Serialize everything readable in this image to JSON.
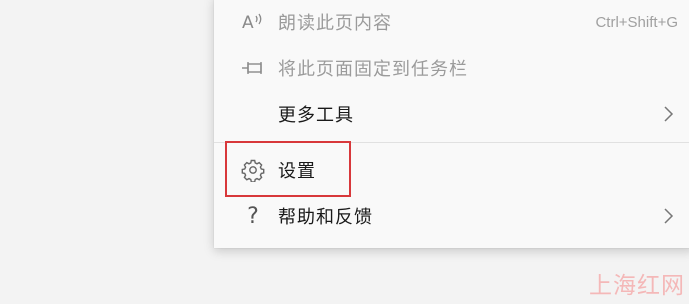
{
  "menu": {
    "items": [
      {
        "label": "朗读此页内容",
        "shortcut": "Ctrl+Shift+G",
        "icon": "read-aloud-icon",
        "disabled": true
      },
      {
        "label": "将此页面固定到任务栏",
        "icon": "pin-icon",
        "disabled": true
      },
      {
        "label": "更多工具",
        "icon": "",
        "submenu": true
      },
      {
        "label": "设置",
        "icon": "gear-icon",
        "highlighted": true
      },
      {
        "label": "帮助和反馈",
        "icon": "help-icon",
        "submenu": true
      }
    ]
  },
  "watermark": {
    "text": "上海红网"
  },
  "colors": {
    "highlight_border": "#d8383b",
    "disabled_text": "#9b9b9b",
    "watermark": "#f4b8b8"
  }
}
